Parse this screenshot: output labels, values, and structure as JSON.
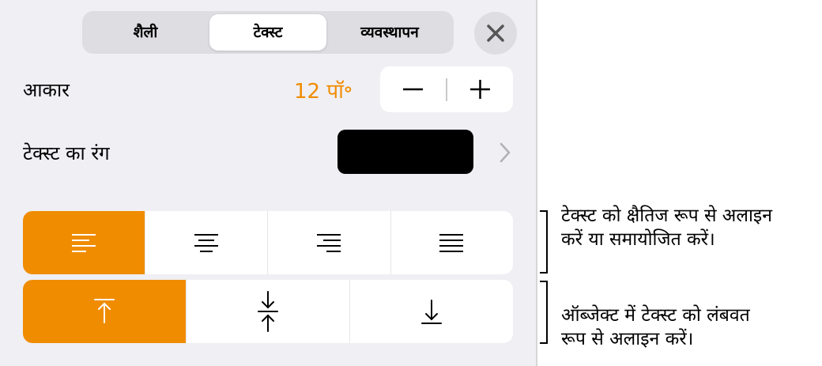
{
  "tabs": [
    {
      "label": "शैली",
      "active": false
    },
    {
      "label": "टेक्स्ट",
      "active": true
    },
    {
      "label": "व्यवस्थापन",
      "active": false
    }
  ],
  "size": {
    "label": "आकार",
    "value": "12 पॉ॰"
  },
  "text_color": {
    "label": "टेक्स्ट का रंग",
    "swatch": "#000000"
  },
  "horizontal_alignment": {
    "options": [
      "left",
      "center",
      "right",
      "justify"
    ],
    "selected": "left"
  },
  "vertical_alignment": {
    "options": [
      "top",
      "middle",
      "bottom"
    ],
    "selected": "top"
  },
  "callouts": {
    "horizontal_line1": "टेक्स्ट को क्षैतिज रूप से अलाइन",
    "horizontal_line2": "करें या समायोजित करें।",
    "vertical_line1": "ऑब्जेक्ट में टेक्स्ट को लंबवत",
    "vertical_line2": "रूप से अलाइन करें।"
  },
  "colors": {
    "accent": "#f08c00",
    "panel": "#efeff4"
  },
  "icons": {
    "close": "close-icon",
    "chevron": "chevron-right-icon"
  }
}
